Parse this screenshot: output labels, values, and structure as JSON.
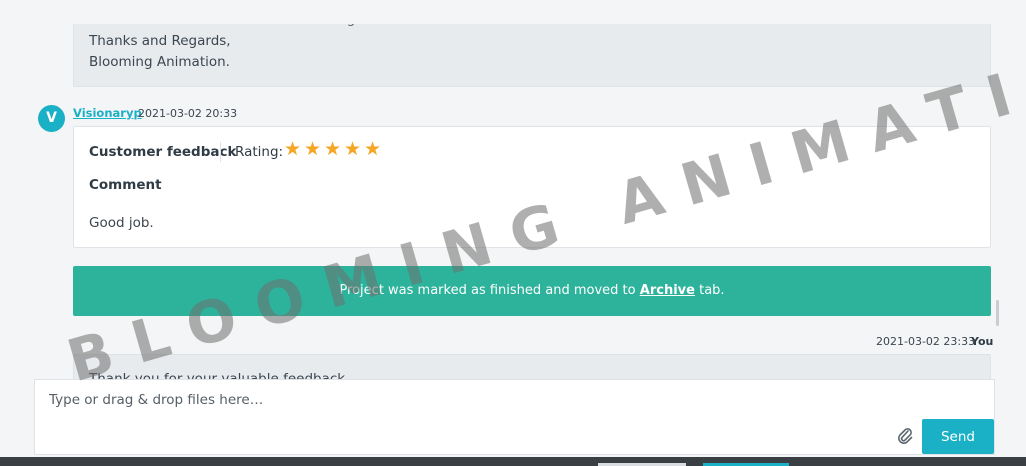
{
  "previous_message": {
    "line1": "You can see that we have done nothing.",
    "line2": "Thanks and Regards,",
    "line3": "Blooming Animation."
  },
  "feedback_message": {
    "avatar_letter": "V",
    "author": "Visionaryp",
    "timestamp": "2021-03-02 20:33",
    "title": "Customer feedback",
    "rating_label": "Rating:",
    "rating_value": 5,
    "rating_max": 5,
    "comment_label": "Comment",
    "comment_text": "Good job."
  },
  "banner": {
    "text_before": "Project was marked as finished and moved to",
    "link_text": "Archive",
    "text_after": "tab."
  },
  "reply": {
    "timestamp": "2021-03-02 23:33",
    "author": "You",
    "text": "Thank you for your valuable feedback."
  },
  "composer": {
    "placeholder": "Type or drag & drop files here…",
    "send_label": "Send"
  },
  "watermark": "BLOOMING ANIMATION",
  "colors": {
    "accent": "#1ab0c5",
    "banner": "#2db39b",
    "star": "#f5a623"
  }
}
